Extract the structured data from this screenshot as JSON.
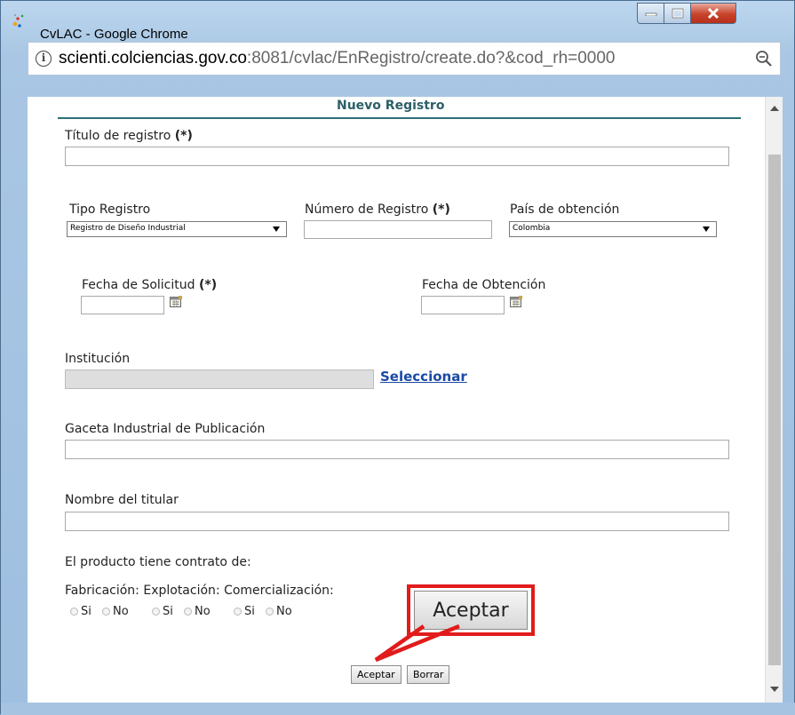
{
  "window": {
    "title": "CvLAC - Google Chrome",
    "url_host": "scienti.colciencias.gov.co",
    "url_rest": ":8081/cvlac/EnRegistro/create.do?&cod_rh=0000"
  },
  "form": {
    "heading": "Nuevo Registro",
    "titulo_label": "Título de registro",
    "required_mark": "(*)",
    "tipo_label": "Tipo Registro",
    "tipo_value": "Registro de Diseño Industrial",
    "numero_label": "Número de Registro",
    "pais_label": "País de obtención",
    "pais_value": "Colombia",
    "fecha_solicitud_label": "Fecha de Solicitud",
    "fecha_obtencion_label": "Fecha de Obtención",
    "institucion_label": "Institución",
    "seleccionar_link": "Seleccionar",
    "gaceta_label": "Gaceta Industrial de Publicación",
    "titular_label": "Nombre del titular",
    "contrato_label": "El producto tiene contrato de:",
    "contrato_types": "Fabricación: Explotación: Comercialización:",
    "radio_si": "Si",
    "radio_no": "No",
    "aceptar_button": "Aceptar",
    "borrar_button": "Borrar",
    "callout_label": "Aceptar"
  },
  "colors": {
    "highlight": "#e21b1b",
    "heading": "#2c5f67",
    "link": "#1b4aa6"
  }
}
